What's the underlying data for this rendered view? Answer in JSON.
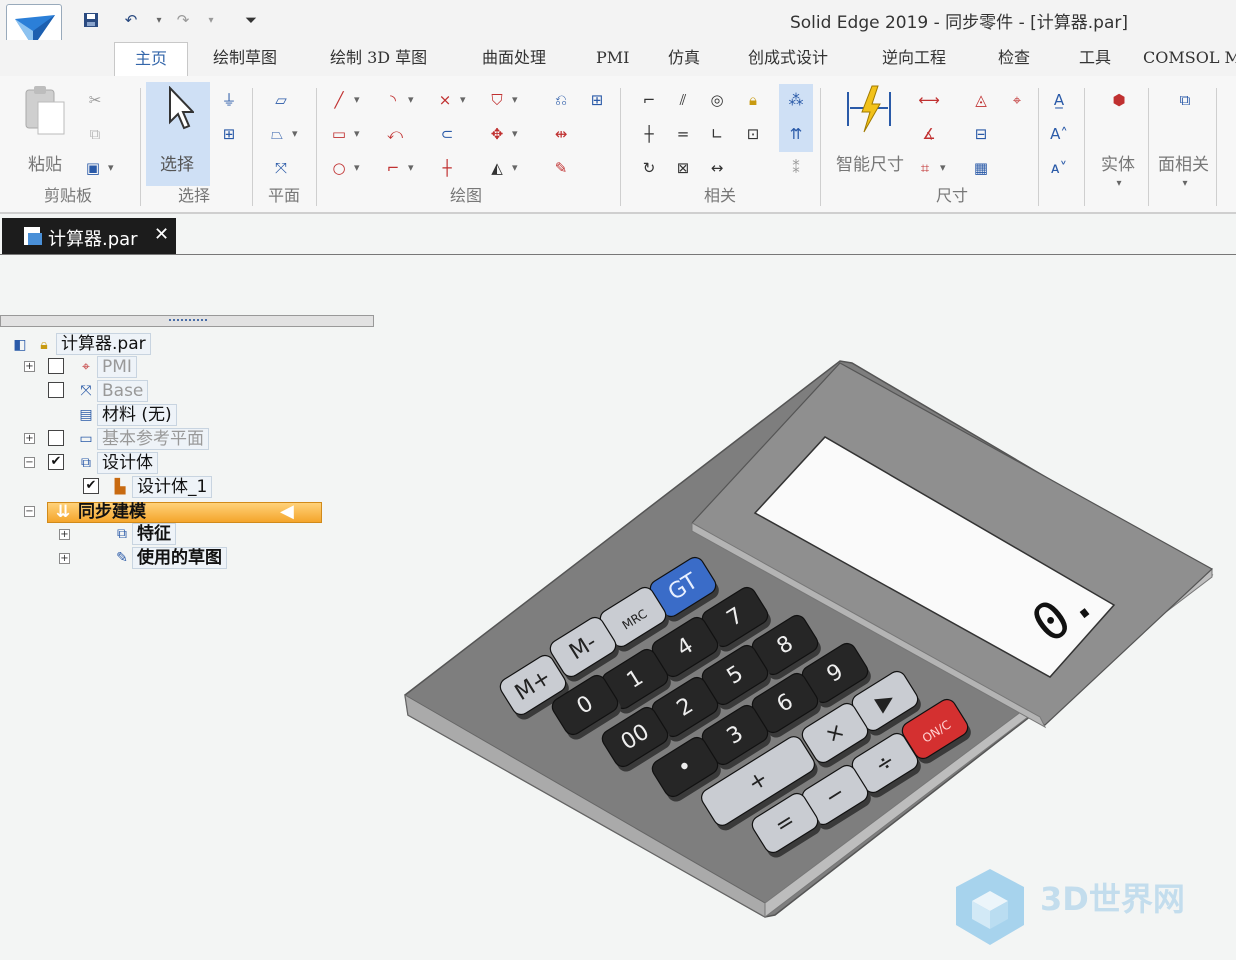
{
  "app": {
    "title": "Solid Edge 2019 - 同步零件 - [计算器.par]",
    "quick_access": [
      "save-icon",
      "undo-icon",
      "redo-icon",
      "customize-qat-icon"
    ]
  },
  "ribbon_tabs": [
    "主页",
    "绘制草图",
    "绘制 3D 草图",
    "曲面处理",
    "PMI",
    "仿真",
    "创成式设计",
    "逆向工程",
    "检查",
    "工具",
    "COMSOL Mul"
  ],
  "ribbon_groups": {
    "clipboard": {
      "label": "剪贴板",
      "paste": "粘贴"
    },
    "select": {
      "label": "选择",
      "button": "选择"
    },
    "plane": {
      "label": "平面"
    },
    "draw": {
      "label": "绘图"
    },
    "relate": {
      "label": "相关"
    },
    "dimension": {
      "label": "尺寸",
      "smart_dimension": "智能尺寸"
    },
    "solid": {
      "label": "实体"
    },
    "face_relate": {
      "label": "面相关"
    }
  },
  "document_tab": {
    "name": "计算器.par",
    "close": "✕"
  },
  "tree": {
    "root": "计算器.par",
    "pmi": "PMI",
    "base": "Base",
    "material": "材料 (无)",
    "ref_planes": "基本参考平面",
    "design_body": "设计体",
    "design_body_1": "设计体_1",
    "sync_modeling": "同步建模",
    "features": "特征",
    "used_sketches": "使用的草图"
  },
  "calculator": {
    "display": "0.",
    "keys": [
      "GT",
      "MRC",
      "M-",
      "M+",
      "7",
      "8",
      "9",
      "4",
      "5",
      "6",
      "1",
      "2",
      "3",
      "0",
      "00",
      "•",
      "▶",
      "×",
      "÷",
      "+",
      "−",
      "=",
      "ON/C"
    ]
  },
  "watermark": {
    "text": "3D世界网"
  },
  "colors": {
    "accent": "#3366aa",
    "select_highlight": "#cfe0f5",
    "sync_highlight": "#f4a52c",
    "key_blue": "#3a6cc8",
    "key_red": "#d43030",
    "body_gray": "#8c8c8c"
  }
}
